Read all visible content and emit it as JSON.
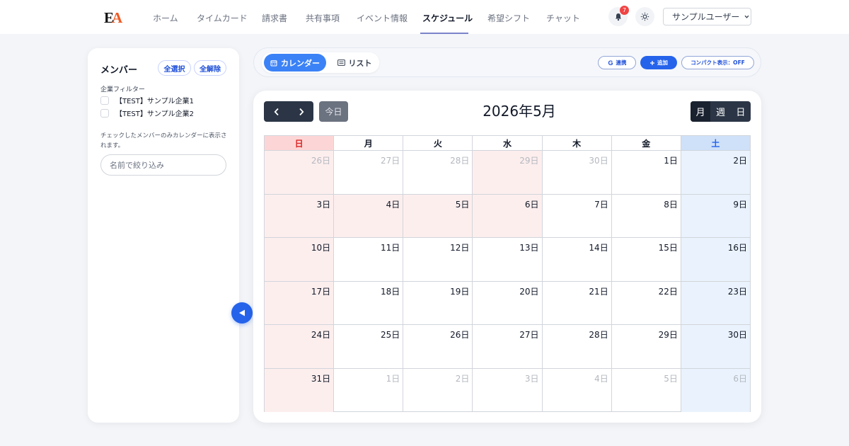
{
  "brand": {
    "logo_text": "EA",
    "accent": "#2563eb"
  },
  "nav": {
    "items": [
      "ホーム",
      "タイムカード",
      "請求書",
      "共有事項",
      "イベント情報",
      "スケジュール",
      "希望シフト",
      "チャット"
    ],
    "active": "スケジュール"
  },
  "header": {
    "notification_count": "7",
    "user_label": "サンプルユーザー"
  },
  "sidebar": {
    "title": "メンバー",
    "select_all": "全選択",
    "deselect_all": "全解除",
    "filter_label": "企業フィルター",
    "companies": [
      "【TEST】サンプル企業1",
      "【TEST】サンプル企業2"
    ],
    "note": "チェックしたメンバーのみカレンダーに表示されます。",
    "search_placeholder": "名前で絞り込み"
  },
  "toolbar": {
    "calendar_label": "カレンダー",
    "list_label": "リスト",
    "google_label": "連携",
    "add_label": "追加",
    "compact_label": "コンパクト表示：OFF"
  },
  "calendar": {
    "title": "2026年5月",
    "today_label": "今日",
    "modes": [
      "月",
      "週",
      "日"
    ],
    "active_mode": "月",
    "weekdays": [
      "日",
      "月",
      "火",
      "水",
      "木",
      "金",
      "土"
    ],
    "weeks": [
      [
        {
          "label": "26日",
          "other": true
        },
        {
          "label": "27日",
          "other": true
        },
        {
          "label": "28日",
          "other": true
        },
        {
          "label": "29日",
          "other": true,
          "holiday": true
        },
        {
          "label": "30日",
          "other": true
        },
        {
          "label": "1日"
        },
        {
          "label": "2日"
        }
      ],
      [
        {
          "label": "3日"
        },
        {
          "label": "4日",
          "holiday": true
        },
        {
          "label": "5日",
          "holiday": true
        },
        {
          "label": "6日",
          "holiday": true
        },
        {
          "label": "7日"
        },
        {
          "label": "8日"
        },
        {
          "label": "9日"
        }
      ],
      [
        {
          "label": "10日"
        },
        {
          "label": "11日"
        },
        {
          "label": "12日"
        },
        {
          "label": "13日"
        },
        {
          "label": "14日"
        },
        {
          "label": "15日"
        },
        {
          "label": "16日"
        }
      ],
      [
        {
          "label": "17日"
        },
        {
          "label": "18日"
        },
        {
          "label": "19日"
        },
        {
          "label": "20日"
        },
        {
          "label": "21日"
        },
        {
          "label": "22日"
        },
        {
          "label": "23日"
        }
      ],
      [
        {
          "label": "24日"
        },
        {
          "label": "25日"
        },
        {
          "label": "26日"
        },
        {
          "label": "27日"
        },
        {
          "label": "28日"
        },
        {
          "label": "29日"
        },
        {
          "label": "30日"
        }
      ],
      [
        {
          "label": "31日"
        },
        {
          "label": "1日",
          "other": true
        },
        {
          "label": "2日",
          "other": true
        },
        {
          "label": "3日",
          "other": true
        },
        {
          "label": "4日",
          "other": true
        },
        {
          "label": "5日",
          "other": true
        },
        {
          "label": "6日",
          "other": true
        }
      ]
    ]
  }
}
